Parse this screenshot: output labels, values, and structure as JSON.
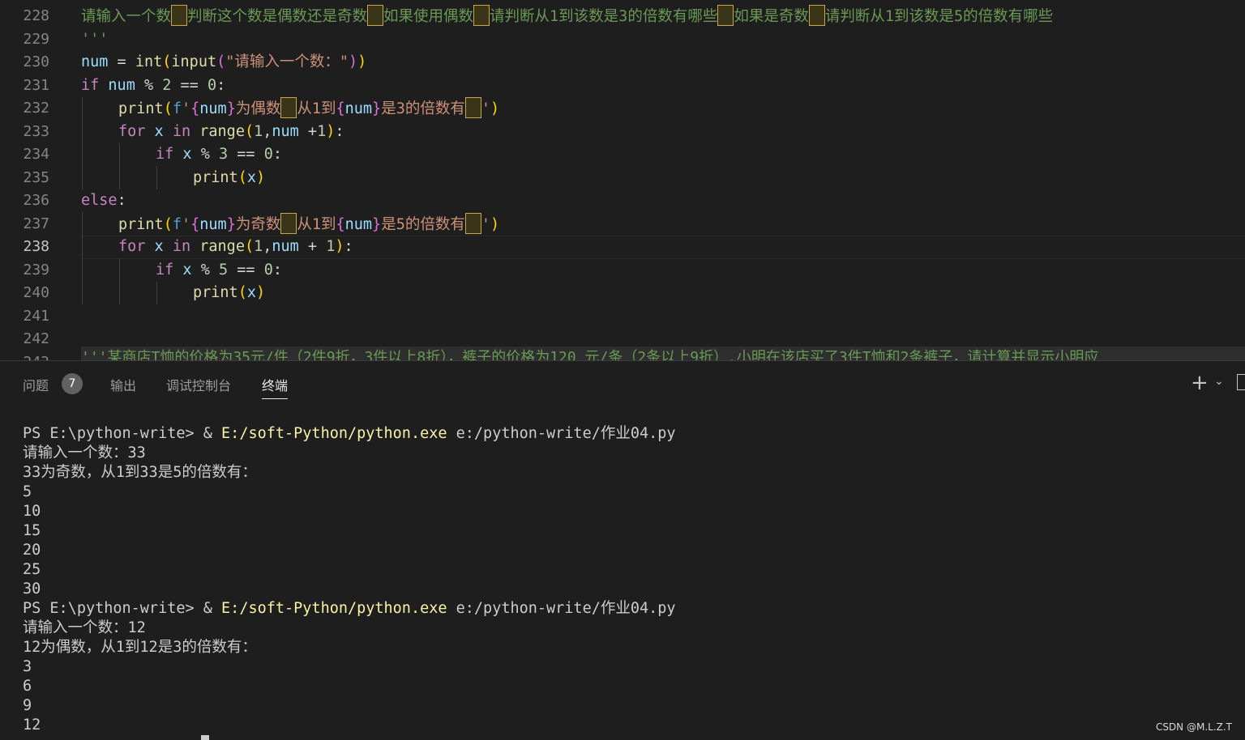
{
  "editor": {
    "line_numbers": [
      "228",
      "229",
      "230",
      "231",
      "232",
      "233",
      "234",
      "235",
      "236",
      "237",
      "238",
      "239",
      "240",
      "241",
      "242",
      "243"
    ],
    "lines": {
      "l228": {
        "a": "请输入一个数",
        "b": "判断这个数是偶数还是奇数",
        "c": "如果使用偶数",
        "d": "请判断从1到该数是3的倍数有哪些",
        "e": "如果是奇数",
        "f": "请判断从1到该数是5的倍数有哪些"
      },
      "l229": "'''",
      "l230": {
        "var": "num",
        "eq": " = ",
        "fn1": "int",
        "p1": "(",
        "fn2": "input",
        "p2": "(",
        "str": "\"请输入一个数：\"",
        "p3": ")",
        "p4": ")"
      },
      "l231": {
        "kw": "if",
        "var": " num",
        "op": " % ",
        "n1": "2",
        "op2": " == ",
        "n2": "0",
        "colon": ":"
      },
      "l232": {
        "fn": "print",
        "p1": "(",
        "f": "f",
        "q": "'",
        "b1": "{",
        "var": "num",
        "b2": "}",
        "s1": "为偶数",
        "s2": "从1到",
        "b3": "{",
        "var2": "num",
        "b4": "}",
        "s3": "是3的倍数有",
        "q2": "'",
        "p2": ")"
      },
      "l233": {
        "kw": "for",
        "var": " x",
        "in": " in",
        "fn": " range",
        "p1": "(",
        "n1": "1",
        "c": ",",
        "var2": "num",
        "op": " +",
        "n2": "1",
        "p2": ")",
        "colon": ":"
      },
      "l234": {
        "kw": "if",
        "var": " x",
        "op": " % ",
        "n1": "3",
        "op2": " == ",
        "n2": "0",
        "colon": ":"
      },
      "l235": {
        "fn": "print",
        "p1": "(",
        "var": "x",
        "p2": ")"
      },
      "l236": {
        "kw": "else",
        "colon": ":"
      },
      "l237": {
        "fn": "print",
        "p1": "(",
        "f": "f",
        "q": "'",
        "b1": "{",
        "var": "num",
        "b2": "}",
        "s1": "为奇数",
        "s2": "从1到",
        "b3": "{",
        "var2": "num",
        "b4": "}",
        "s3": "是5的倍数有",
        "q2": "'",
        "p2": ")"
      },
      "l238": {
        "kw": "for",
        "var": " x",
        "in": " in",
        "fn": " range",
        "p1": "(",
        "n1": "1",
        "c": ",",
        "var2": "num",
        "op": " + ",
        "n2": "1",
        "p2": ")",
        "colon": ":"
      },
      "l239": {
        "kw": "if",
        "var": " x",
        "op": " % ",
        "n1": "5",
        "op2": " == ",
        "n2": "0",
        "colon": ":"
      },
      "l240": {
        "fn": "print",
        "p1": "(",
        "var": "x",
        "p2": ")"
      },
      "l243": "'''某商店T恤的价格为35元/件（2件9折，3件以上8折），裤子的价格为120 元/条（2条以上9折）.小明在该店买了3件T恤和2条裤子，请计算并显示小明应"
    }
  },
  "panel": {
    "tabs": [
      {
        "label": "问题",
        "badge": "7"
      },
      {
        "label": "输出"
      },
      {
        "label": "调试控制台"
      },
      {
        "label": "终端",
        "active": true
      }
    ],
    "icons": [
      "plus-icon",
      "chevron-down-icon",
      "split-icon"
    ]
  },
  "terminal": {
    "prompt1": "PS E:\\python-write> & ",
    "exe": "E:/soft-Python/python.exe",
    "script": " e:/python-write/作业04.py",
    "lines": [
      "请输入一个数：33",
      "33为奇数，从1到33是5的倍数有：",
      "5",
      "10",
      "15",
      "20",
      "25",
      "30"
    ],
    "lines2": [
      "请输入一个数：12",
      "12为偶数，从1到12是3的倍数有：",
      "3",
      "6",
      "9",
      "12"
    ]
  },
  "watermark": "CSDN @M.L.Z.T"
}
